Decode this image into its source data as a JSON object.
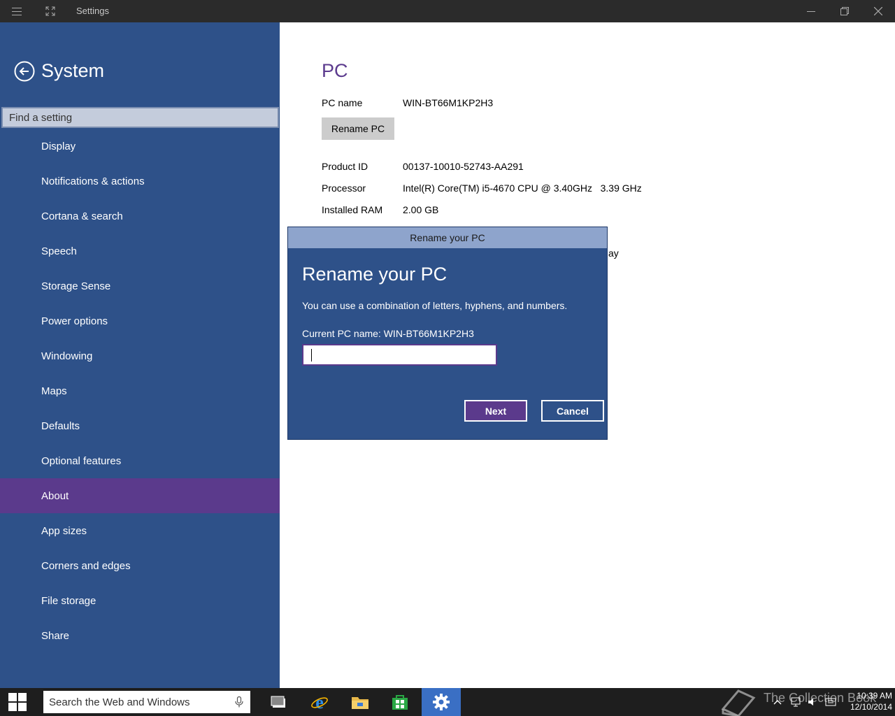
{
  "window": {
    "title": "Settings",
    "icons": [
      "hamburger-icon",
      "fullscreen-icon",
      "minimize-icon",
      "restore-icon",
      "close-icon"
    ]
  },
  "sidebar": {
    "title": "System",
    "search_placeholder": "Find a setting",
    "items": [
      {
        "label": "Display"
      },
      {
        "label": "Notifications & actions"
      },
      {
        "label": "Cortana & search"
      },
      {
        "label": "Speech"
      },
      {
        "label": "Storage Sense"
      },
      {
        "label": "Power options"
      },
      {
        "label": "Windowing"
      },
      {
        "label": "Maps"
      },
      {
        "label": "Defaults"
      },
      {
        "label": "Optional features"
      },
      {
        "label": "About",
        "selected": true
      },
      {
        "label": "App sizes"
      },
      {
        "label": "Corners and edges"
      },
      {
        "label": "File storage"
      },
      {
        "label": "Share"
      }
    ]
  },
  "main": {
    "section_title": "PC",
    "pc_name_label": "PC name",
    "pc_name_value": "WIN-BT66M1KP2H3",
    "rename_button": "Rename PC",
    "product_id_label": "Product ID",
    "product_id_value": "00137-10010-52743-AA291",
    "processor_label": "Processor",
    "processor_value": "Intel(R) Core(TM) i5-4670 CPU @ 3.40GHz   3.39 GHz",
    "ram_label": "Installed RAM",
    "ram_value": "2.00 GB",
    "partial_text": "ay"
  },
  "dialog": {
    "titlebar": "Rename your PC",
    "heading": "Rename your PC",
    "description": "You can use a combination of letters, hyphens, and numbers.",
    "current_name": "Current PC name: WIN-BT66M1KP2H3",
    "input_value": "",
    "next_label": "Next",
    "cancel_label": "Cancel"
  },
  "taskbar": {
    "search_placeholder": "Search the Web and Windows",
    "apps": [
      "task-view-icon",
      "internet-explorer-icon",
      "file-explorer-icon",
      "store-icon",
      "settings-icon"
    ],
    "watermark": "The Collection Book",
    "time": "10:39 AM",
    "date": "12/10/2014"
  },
  "colors": {
    "sidebar_bg": "#2e5189",
    "selected_item": "#5b3a8c",
    "accent_purple": "#5c3b8e",
    "titlebar_bg": "#2b2b2b",
    "dialog_titlebar": "#8ea4cc",
    "taskbar_bg": "#1e1e1e",
    "taskbar_active": "#3a6fc4"
  }
}
